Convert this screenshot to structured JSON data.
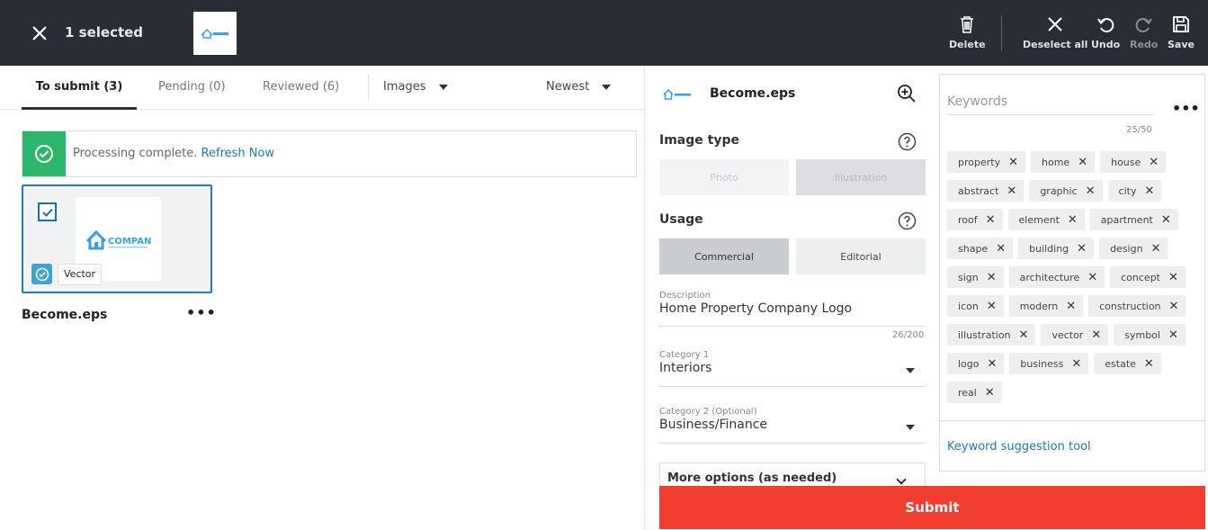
{
  "topbar": {
    "selected_text": "1 selected",
    "actions": [
      {
        "label": "Delete"
      },
      {
        "label": "Deselect all"
      },
      {
        "label": "Undo"
      },
      {
        "label": "Redo"
      },
      {
        "label": "Save"
      }
    ]
  },
  "tabs": [
    {
      "label": "To submit (3)"
    },
    {
      "label": "Pending (0)"
    },
    {
      "label": "Reviewed (6)"
    }
  ],
  "filters": {
    "type": "Images",
    "sort": "Newest"
  },
  "notice": {
    "text": "Processing complete. ",
    "link": "Refresh Now"
  },
  "asset": {
    "type_tag": "Vector",
    "filename": "Become.eps",
    "logo_text": "COMPANY"
  },
  "details": {
    "title": "Become.eps",
    "image_type_label": "Image type",
    "image_types": [
      "Photo",
      "Illustration"
    ],
    "usage_label": "Usage",
    "usage_options": [
      "Commercial",
      "Editorial"
    ],
    "description_label": "Description",
    "description_value": "Home Property Company Logo",
    "description_count": "26/200",
    "category1_label": "Category 1",
    "category1_value": "Interiors",
    "category2_label": "Category 2 (Optional)",
    "category2_value": "Business/Finance",
    "more_options": "More options (as needed)",
    "submit_label": "Submit"
  },
  "keywords": {
    "placeholder": "Keywords",
    "count": "25/50",
    "items": [
      "property",
      "home",
      "house",
      "abstract",
      "graphic",
      "city",
      "roof",
      "element",
      "apartment",
      "shape",
      "building",
      "design",
      "sign",
      "architecture",
      "concept",
      "icon",
      "modern",
      "construction",
      "illustration",
      "vector",
      "symbol",
      "logo",
      "business",
      "estate",
      "real"
    ],
    "suggestion_link": "Keyword suggestion tool"
  }
}
